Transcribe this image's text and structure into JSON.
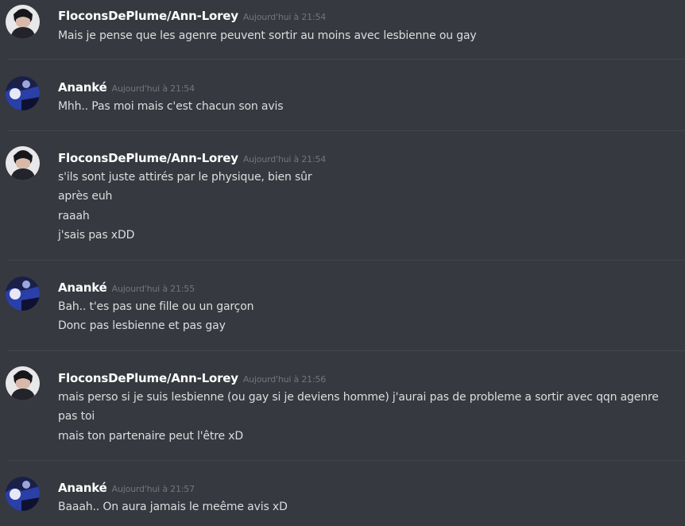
{
  "messages": [
    {
      "author": "FloconsDePlume/Ann-Lorey",
      "avatar": "avatar-floconsdeplume",
      "timestamp": "Aujourd'hui à 21:54",
      "lines": [
        "Mais je pense que les agenre peuvent sortir au moins avec lesbienne ou gay"
      ]
    },
    {
      "author": "Ananké",
      "avatar": "avatar-ananke",
      "timestamp": "Aujourd'hui à 21:54",
      "lines": [
        "Mhh.. Pas moi mais c'est chacun son avis"
      ]
    },
    {
      "author": "FloconsDePlume/Ann-Lorey",
      "avatar": "avatar-floconsdeplume",
      "timestamp": "Aujourd'hui à 21:54",
      "lines": [
        "s'ils sont juste attirés par le physique, bien sûr",
        "après euh",
        "raaah",
        "j'sais pas xDD"
      ]
    },
    {
      "author": "Ananké",
      "avatar": "avatar-ananke",
      "timestamp": "Aujourd'hui à 21:55",
      "lines": [
        "Bah.. t'es pas une fille ou un garçon",
        "Donc pas lesbienne et pas gay"
      ]
    },
    {
      "author": "FloconsDePlume/Ann-Lorey",
      "avatar": "avatar-floconsdeplume",
      "timestamp": "Aujourd'hui à 21:56",
      "lines": [
        "mais perso si je suis lesbienne (ou gay si je deviens homme) j'aurai pas de probleme a sortir avec qqn agenre",
        "pas toi",
        "mais ton partenaire peut l'être xD"
      ]
    },
    {
      "author": "Ananké",
      "avatar": "avatar-ananke",
      "timestamp": "Aujourd'hui à 21:57",
      "lines": [
        "Baaah.. On aura jamais le meême avis xD"
      ]
    }
  ],
  "colors": {
    "background": "#36393f",
    "username": "#ffffff",
    "timestamp": "#72767d",
    "text": "#dcddde",
    "divider": "#42454a"
  }
}
